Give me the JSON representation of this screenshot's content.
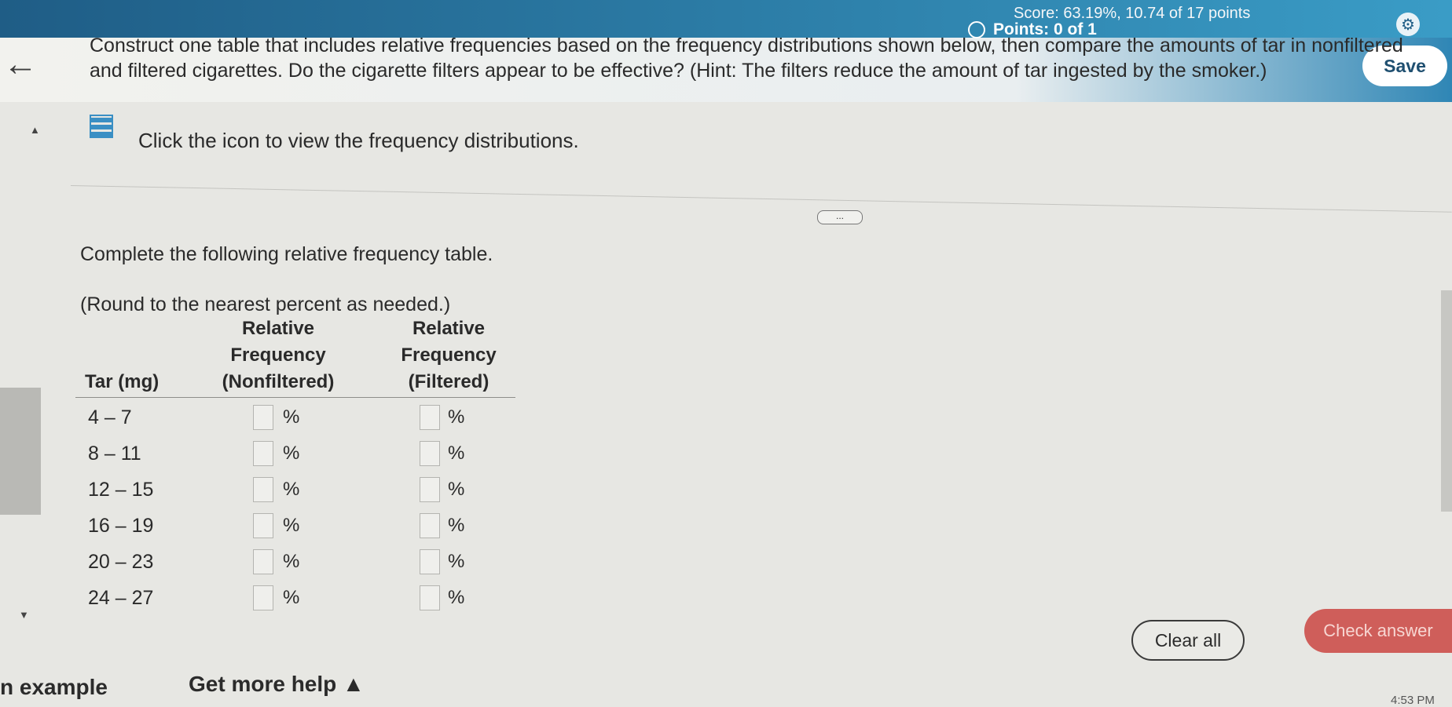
{
  "header": {
    "score_text": "Score: 63.19%, 10.74 of 17 points",
    "points_text": "Points: 0 of 1",
    "save_label": "Save"
  },
  "question": {
    "prompt": "Construct one table that includes relative frequencies based on the frequency distributions shown below, then compare the amounts of tar in nonfiltered and filtered cigarettes. Do the cigarette filters appear to be effective? (Hint: The filters reduce the amount of tar ingested by the smoker.)",
    "icon_text": "Click the icon to view the frequency distributions.",
    "dots_label": "...",
    "instructions": "Complete the following relative frequency table.",
    "rounding": "(Round to the nearest percent as needed.)"
  },
  "table": {
    "headers": {
      "tar": "Tar (mg)",
      "nonfiltered": "Relative Frequency (Nonfiltered)",
      "filtered": "Relative Frequency (Filtered)"
    },
    "rows": [
      {
        "range": "4 – 7",
        "unit_a": "%",
        "unit_b": "%"
      },
      {
        "range": "8 – 11",
        "unit_a": "%",
        "unit_b": "%"
      },
      {
        "range": "12 – 15",
        "unit_a": "%",
        "unit_b": "%"
      },
      {
        "range": "16 – 19",
        "unit_a": "%",
        "unit_b": "%"
      },
      {
        "range": "20 – 23",
        "unit_a": "%",
        "unit_b": "%"
      },
      {
        "range": "24 – 27",
        "unit_a": "%",
        "unit_b": "%"
      }
    ]
  },
  "footer": {
    "clear_label": "Clear all",
    "check_label": "Check answer",
    "example_label": "n example",
    "help_label": "Get more help ▲",
    "clock": "4:53 PM"
  },
  "icons": {
    "back": "arrow-left-icon",
    "settings": "gear-icon",
    "table": "grid-icon"
  },
  "colors": {
    "header_blue": "#2d7fa9",
    "check_answer": "#cf5e5a"
  }
}
